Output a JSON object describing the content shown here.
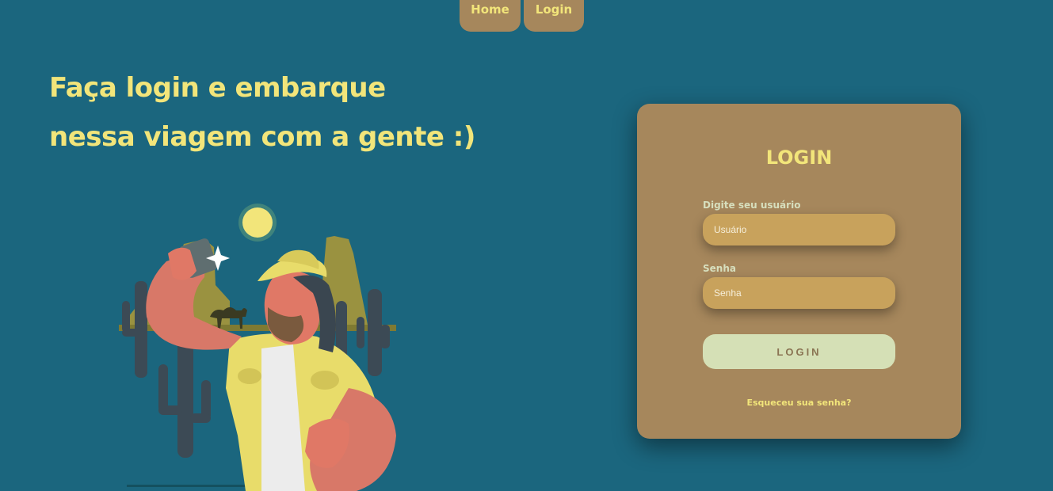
{
  "nav": {
    "home_label": "Home",
    "login_label": "Login"
  },
  "hero": {
    "line1": "Faça login e embarque",
    "line2": "nessa viagem com a gente :)"
  },
  "login_card": {
    "title": "LOGIN",
    "username_label": "Digite seu usuário",
    "username_placeholder": "Usuário",
    "password_label": "Senha",
    "password_placeholder": "Senha",
    "submit_label": "LOGIN",
    "forgot_label": "Esqueceu sua senha?"
  },
  "colors": {
    "background": "#1b667e",
    "card": "#a6875c",
    "accent_yellow": "#f2e57a",
    "input": "#c8a25c",
    "button": "#d5e0b6"
  },
  "illustration": {
    "icon": "traveler-selfie-desert-illustration"
  }
}
